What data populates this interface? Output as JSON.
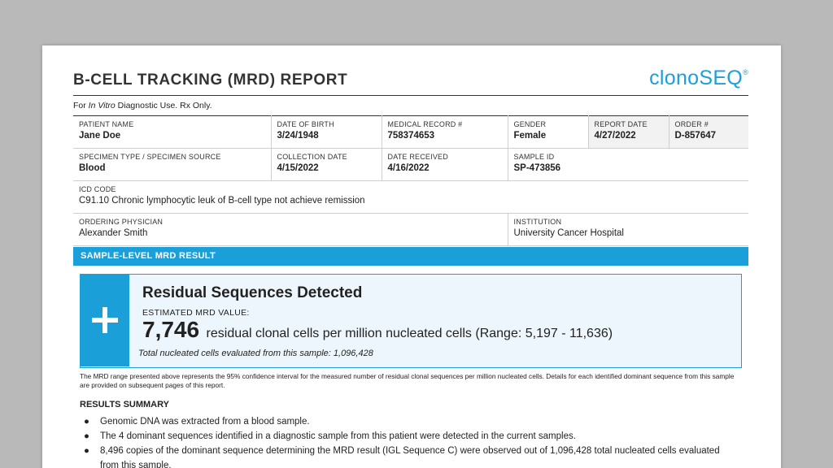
{
  "report": {
    "title": "B-CELL TRACKING (MRD) REPORT",
    "logo": {
      "prefix": "clono",
      "suffix": "SEQ",
      "mark": "®"
    },
    "ivd_prefix": "For ",
    "ivd_italic": "In Vitro",
    "ivd_suffix": " Diagnostic Use. Rx Only."
  },
  "patient": {
    "name_label": "PATIENT NAME",
    "name": "Jane Doe",
    "dob_label": "DATE OF BIRTH",
    "dob": "3/24/1948",
    "mrn_label": "MEDICAL RECORD #",
    "mrn": "758374653",
    "gender_label": "GENDER",
    "gender": "Female",
    "report_date_label": "REPORT DATE",
    "report_date": "4/27/2022",
    "order_label": "ORDER #",
    "order": "D-857647"
  },
  "specimen": {
    "type_label": "SPECIMEN TYPE / SPECIMEN SOURCE",
    "type": "Blood",
    "collection_label": "COLLECTION DATE",
    "collection": "4/15/2022",
    "received_label": "DATE RECEIVED",
    "received": "4/16/2022",
    "sample_id_label": "SAMPLE ID",
    "sample_id": "SP-473856"
  },
  "icd": {
    "label": "ICD CODE",
    "value": "C91.10 Chronic lymphocytic leuk of B-cell type not achieve remission"
  },
  "ordering": {
    "physician_label": "ORDERING PHYSICIAN",
    "physician": "Alexander Smith",
    "institution_label": "INSTITUTION",
    "institution": "University Cancer Hospital"
  },
  "result": {
    "section_title": "SAMPLE-LEVEL MRD RESULT",
    "status": "Residual  Sequences Detected",
    "estimate_label": "ESTIMATED  MRD VALUE:",
    "value": "7,746",
    "value_desc": "residual clonal cells per million nucleated cells (Range: 5,197 - 11,636)",
    "cells_evaluated": "Total nucleated  cells evaluated  from this sample: 1,096,428",
    "footnote": "The MRD range presented above represents the 95% confidence interval for the measured number of residual clonal sequences per million nucleated cells. Details for each identified dominant sequence from this sample are provided on subsequent pages of this report.",
    "accent_color": "#1a9fd9"
  },
  "summary": {
    "title": "RESULTS SUMMARY",
    "items": [
      "Genomic  DNA was extracted  from a blood sample.",
      "The 4 dominant sequences identified in a diagnostic sample from this patient were detected in the current samples.",
      "8,496 copies of the dominant sequence determining the MRD result (IGL Sequence C) were observed out of 1,096,428  total nucleated cells evaluated  from this sample."
    ]
  }
}
